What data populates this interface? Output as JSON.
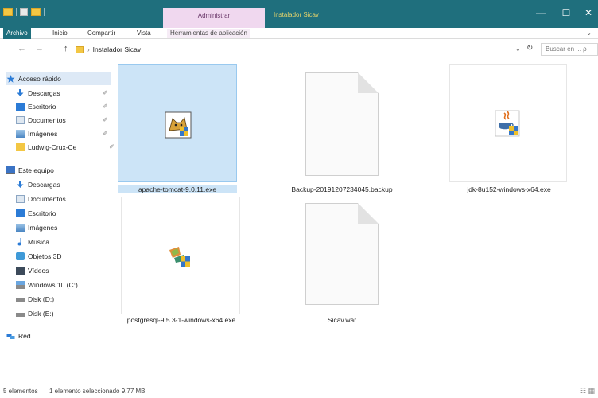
{
  "window": {
    "title": "Instalador Sicav",
    "context_tab": "Administrar",
    "controls": {
      "minimize": "—",
      "maximize": "☐",
      "close": "✕"
    }
  },
  "ribbon": {
    "tabs": [
      "Archivo",
      "Inicio",
      "Compartir",
      "Vista",
      "Herramientas de aplicación"
    ],
    "expand_chevron": "⌄"
  },
  "address": {
    "back": "←",
    "forward": "→",
    "up": "↑",
    "crumb_sep": "›",
    "path": "Instalador Sicav",
    "dropdown": "⌄",
    "refresh": "↻",
    "search_placeholder": "Buscar en ... ρ"
  },
  "sidebar": {
    "quick_access": "Acceso rápido",
    "quick_items": [
      {
        "label": "Descargas",
        "icon": "download-icon",
        "pinned": true
      },
      {
        "label": "Escritorio",
        "icon": "desktop-icon",
        "pinned": true
      },
      {
        "label": "Documentos",
        "icon": "documents-icon",
        "pinned": true
      },
      {
        "label": "Imágenes",
        "icon": "pictures-icon",
        "pinned": true
      },
      {
        "label": "Ludwig-Crux-Ce",
        "icon": "folder-icon",
        "pinned": true
      }
    ],
    "pin_glyph": "✐",
    "this_pc": "Este equipo",
    "pc_items": [
      {
        "label": "Descargas",
        "icon": "download-icon"
      },
      {
        "label": "Documentos",
        "icon": "documents-icon"
      },
      {
        "label": "Escritorio",
        "icon": "desktop-icon"
      },
      {
        "label": "Imágenes",
        "icon": "pictures-icon"
      },
      {
        "label": "Música",
        "icon": "music-icon"
      },
      {
        "label": "Objetos 3D",
        "icon": "objects3d-icon"
      },
      {
        "label": "Vídeos",
        "icon": "videos-icon"
      },
      {
        "label": "Windows 10 (C:)",
        "icon": "drive-c-icon"
      },
      {
        "label": "Disk (D:)",
        "icon": "drive-icon"
      },
      {
        "label": "Disk (E:)",
        "icon": "drive-icon"
      }
    ],
    "network": "Red"
  },
  "files": [
    {
      "name": "apache-tomcat-9.0.11.exe",
      "icon": "tomcat-installer-icon",
      "selected": true
    },
    {
      "name": "Backup-20191207234045.backup",
      "icon": "generic-file-icon",
      "selected": false
    },
    {
      "name": "jdk-8u152-windows-x64.exe",
      "icon": "java-installer-icon",
      "selected": false
    },
    {
      "name": "postgresql-9.5.3-1-windows-x64.exe",
      "icon": "postgresql-installer-icon",
      "selected": false
    },
    {
      "name": "Sicav.war",
      "icon": "generic-file-icon",
      "selected": false
    }
  ],
  "status": {
    "count": "5 elementos",
    "selection": "1 elemento seleccionado  9,77 MB",
    "views": "☷ ▦"
  },
  "colors": {
    "titlebar": "#1f6f7d",
    "context_tab": "#f0d8ef",
    "selection": "#cce4f7"
  }
}
